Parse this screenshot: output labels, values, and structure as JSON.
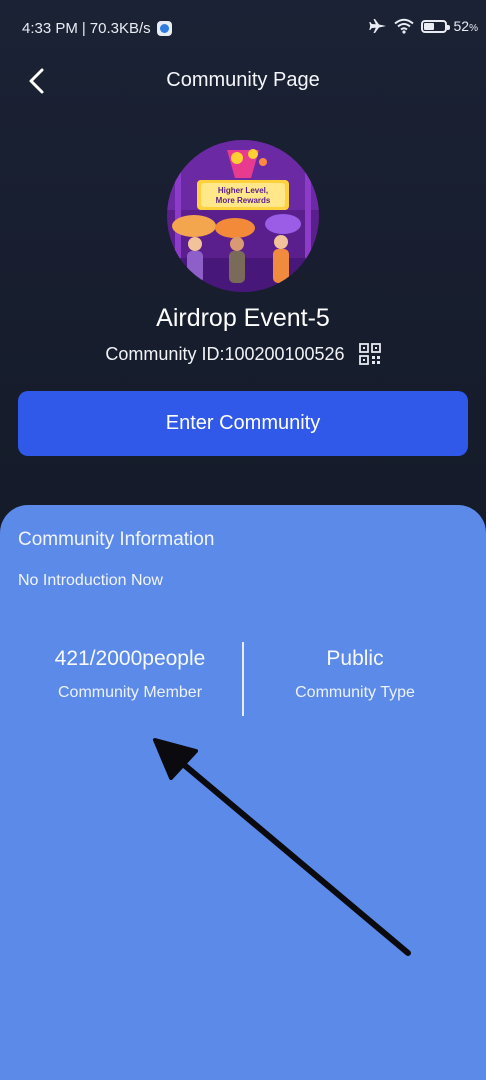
{
  "status_bar": {
    "time": "4:33 PM",
    "separator": "|",
    "speed": "70.3KB/s",
    "battery_percent": 52,
    "battery_label": "52"
  },
  "header": {
    "title": "Community Page"
  },
  "community": {
    "name": "Airdrop Event-5",
    "id_text": "Community ID:100200100526",
    "avatar_caption_line1": "Higher Level,",
    "avatar_caption_line2": "More Rewards"
  },
  "actions": {
    "enter_label": "Enter Community"
  },
  "info": {
    "section_title": "Community Information",
    "introduction": "No Introduction Now",
    "member_value": "421/2000people",
    "member_label": "Community Member",
    "type_value": "Public",
    "type_label": "Community Type"
  },
  "colors": {
    "background": "#161d2d",
    "button": "#3059e9",
    "card": "#5b8ae8"
  }
}
